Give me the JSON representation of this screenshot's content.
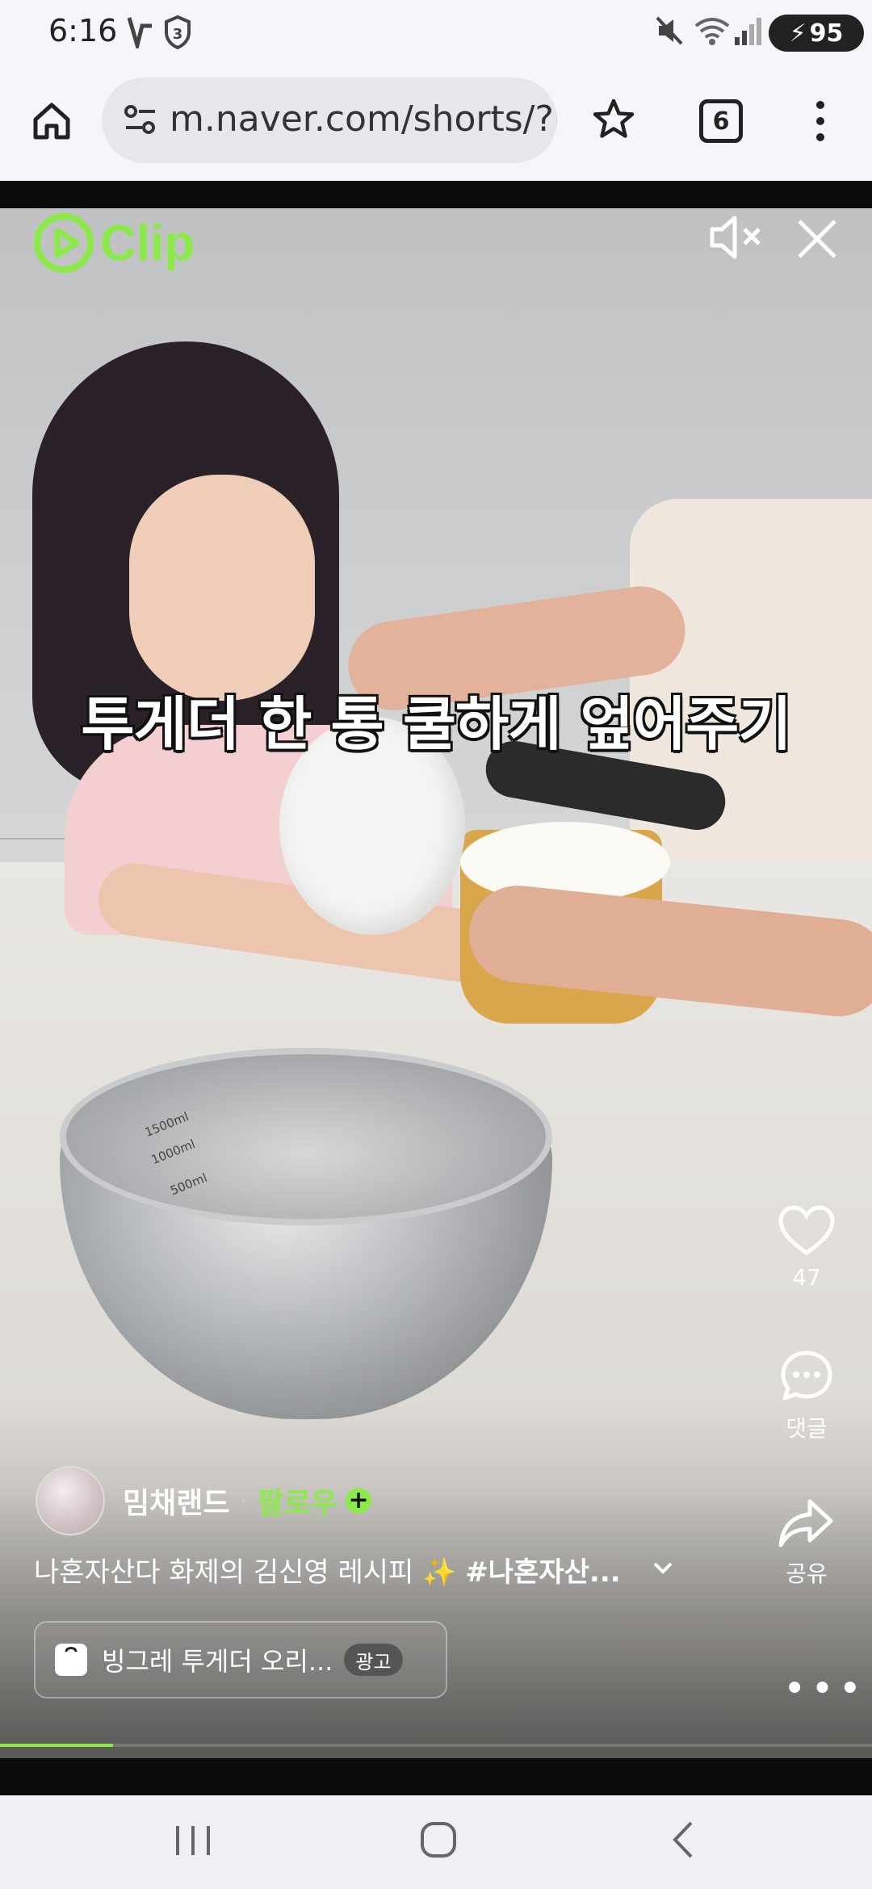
{
  "status_bar": {
    "time": "6:16",
    "shield_badge": "3",
    "battery": "95"
  },
  "browser": {
    "url": "m.naver.com/shorts/?r",
    "tab_count": "6"
  },
  "video": {
    "subtitle": "투게더 한 통 쿨하게 엎어주기",
    "bowl_markings": [
      "1500ml",
      "1000ml",
      "500ml"
    ],
    "progress": 0.13
  },
  "clip": {
    "logo": "Clip",
    "accent_color": "#8bea4a"
  },
  "side_actions": {
    "like_count": "47",
    "comment_label": "댓글",
    "share_label": "공유"
  },
  "author": {
    "name": "밈채랜드",
    "separator": "·",
    "follow_label": "팔로우"
  },
  "caption": {
    "text": "나혼자산다 화제의 김신영 레시피 ✨ ",
    "hashtag": "#나혼자산..."
  },
  "ad": {
    "text": "빙그레 투게더 오리...",
    "badge": "광고"
  },
  "icons": [
    "home-icon",
    "site-settings-icon",
    "star-icon",
    "tab-switcher-icon",
    "menu-icon",
    "mute-icon",
    "close-icon",
    "heart-icon",
    "comment-icon",
    "share-icon",
    "more-icon",
    "chevron-down-icon",
    "shopping-bag-icon",
    "recent-apps-icon",
    "home-nav-icon",
    "back-icon"
  ]
}
